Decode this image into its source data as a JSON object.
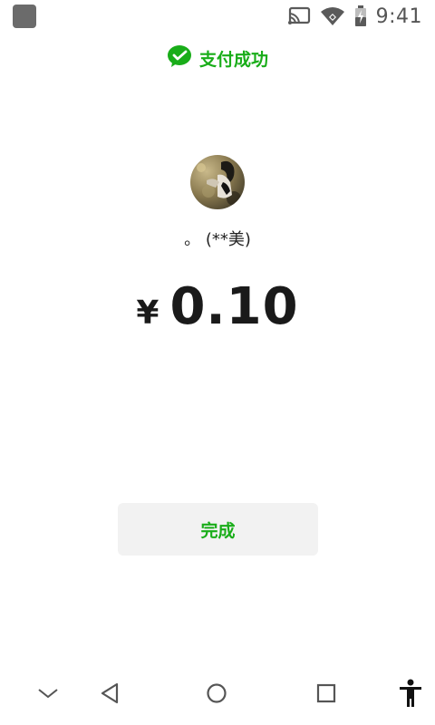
{
  "status_bar": {
    "time": "9:41",
    "icons": [
      "cast-icon",
      "wifi-icon",
      "battery-charging-icon"
    ]
  },
  "header": {
    "icon": "wechat-pay-icon",
    "title": "支付成功"
  },
  "payee": {
    "avatar": "avatar-photo",
    "name": "。 (**美)"
  },
  "amount": {
    "currency": "¥",
    "value": "0.10"
  },
  "actions": {
    "done_label": "完成"
  },
  "nav_bar": {
    "icons": [
      "chevron-down-icon",
      "back-icon",
      "home-icon",
      "recents-icon",
      "accessibility-icon"
    ]
  },
  "colors": {
    "accent": "#19ad19",
    "button_bg": "#f2f2f2",
    "text": "#1a1a1a"
  }
}
